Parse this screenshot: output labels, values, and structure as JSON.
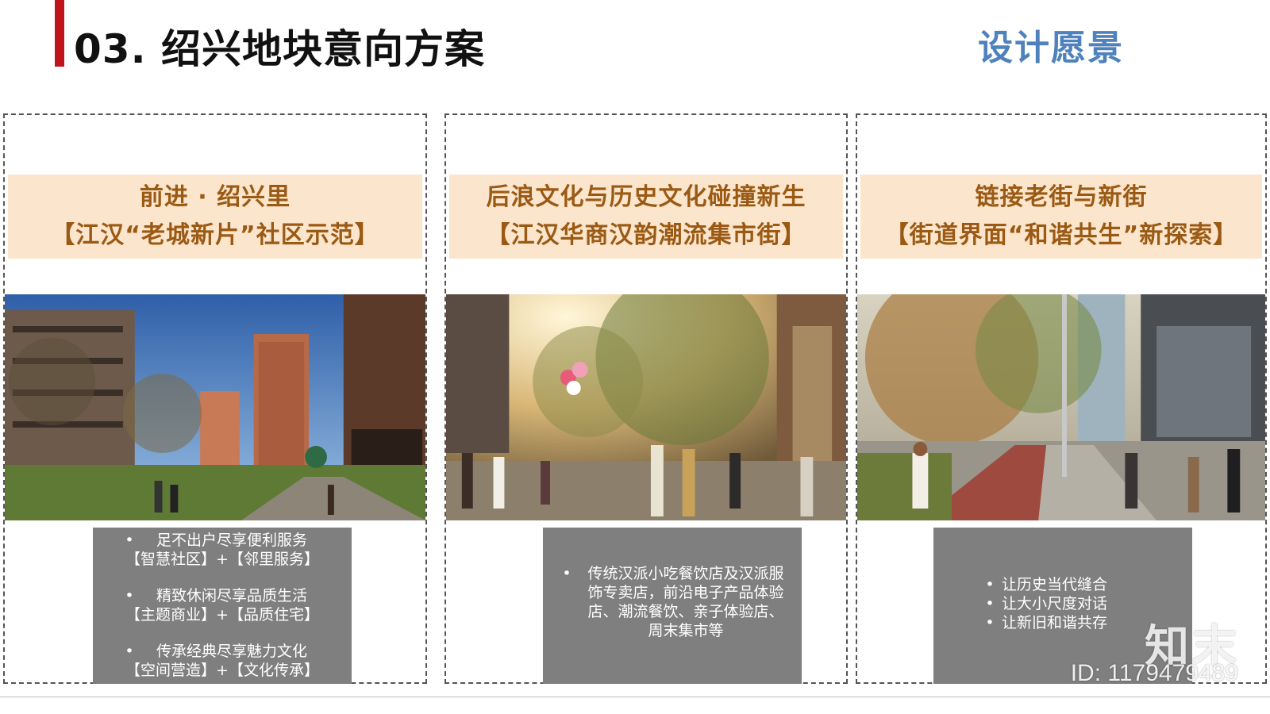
{
  "header": {
    "title": "03. 绍兴地块意向方案",
    "section_tag": "设计愿景"
  },
  "panels": [
    {
      "caption_line1": "前进 · 绍兴里",
      "caption_line2": "【江汉“老城新片”社区示范】",
      "photo": "residential-street-photo",
      "notes": [
        {
          "bullet": "•",
          "text": "足不出户尽享便利服务",
          "sub": "【智慧社区】+【邻里服务】"
        },
        {
          "bullet": "•",
          "text": "精致休闲尽享品质生活",
          "sub": "【主题商业】+【品质住宅】"
        },
        {
          "bullet": "•",
          "text": "传承经典尽享魅力文化",
          "sub": "【空间营造】+【文化传承】"
        }
      ]
    },
    {
      "caption_line1": "后浪文化与历史文化碰撞新生",
      "caption_line2": "【江汉华商汉韵潮流集市街】",
      "photo": "market-street-photo",
      "notes": [
        {
          "bullet": "•",
          "text": "传统汉派小吃餐饮店及汉派服饰专卖店，前沿电子产品体验店、潮流餐饮、亲子体验店、周末集市等"
        }
      ]
    },
    {
      "caption_line1": "链接老街与新街",
      "caption_line2": "【街道界面“和谐共生”新探索】",
      "photo": "boulevard-street-photo",
      "notes": [
        {
          "bullet": "•",
          "text": "让历史当代缝合"
        },
        {
          "bullet": "•",
          "text": "让大小尺度对话"
        },
        {
          "bullet": "•",
          "text": "让新旧和谐共存"
        }
      ]
    }
  ],
  "watermark": {
    "logo_text": "知末",
    "id_text": "ID: 1179479489"
  },
  "colors": {
    "title_bar": "#c0141c",
    "section_tag": "#4f81bd",
    "caption_band": "#fbe5cc",
    "caption_text": "#9b5a14",
    "note_box": "#7f7f7f"
  }
}
